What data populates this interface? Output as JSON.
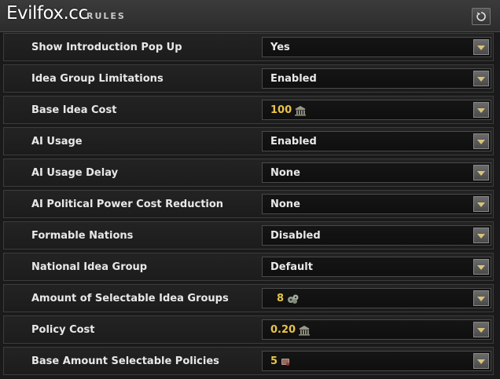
{
  "watermark": "Evilfox.cc",
  "header": {
    "title": "RULES"
  },
  "rules": [
    {
      "label": "Show Introduction Pop Up",
      "value": "Yes"
    },
    {
      "label": "Idea Group Limitations",
      "value": "Enabled"
    },
    {
      "label": "Base Idea Cost",
      "value": "100",
      "icon": "building-icon",
      "gold": true
    },
    {
      "label": "AI Usage",
      "value": "Enabled"
    },
    {
      "label": "AI Usage Delay",
      "value": "None"
    },
    {
      "label": "AI Political Power Cost Reduction",
      "value": "None"
    },
    {
      "label": "Formable Nations",
      "value": "Disabled"
    },
    {
      "label": "National Idea Group",
      "value": "Default"
    },
    {
      "label": "Amount of Selectable Idea Groups",
      "value": "8",
      "icon": "gear-cluster-icon",
      "gold": true
    },
    {
      "label": "Policy Cost",
      "value": "0.20",
      "icon": "building-icon",
      "gold": true
    },
    {
      "label": "Base Amount Selectable Policies",
      "value": "5",
      "icon": "scroll-icon",
      "gold": true
    }
  ]
}
